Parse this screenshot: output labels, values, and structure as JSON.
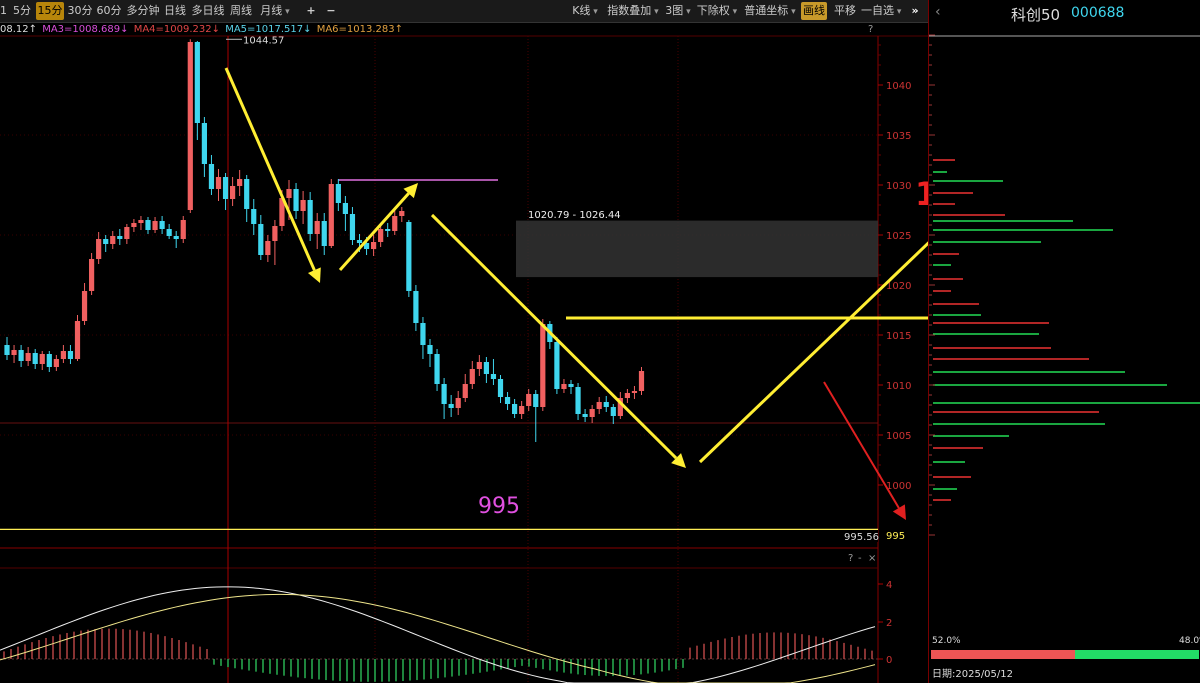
{
  "toolbar": {
    "periods": [
      "5分",
      "15分",
      "30分",
      "60分",
      "多分钟",
      "日线",
      "多日线",
      "周线",
      "月线"
    ],
    "active_period": "15分",
    "first_partial": "1",
    "zoom_in": "+",
    "zoom_out": "−",
    "right_buttons": [
      "K线",
      "指数叠加",
      "3图",
      "下除权",
      "普通坐标",
      "画线",
      "平移",
      "一自选"
    ],
    "collapse": "»"
  },
  "ma_legend": [
    {
      "text": "08.12↑",
      "color": "#dddddd"
    },
    {
      "text": "MA3=1008.689↓",
      "color": "#d84fd8"
    },
    {
      "text": "MA4=1009.232↓",
      "color": "#e04646"
    },
    {
      "text": "MA5=1017.517↓",
      "color": "#5ad2e8"
    },
    {
      "text": "MA6=1013.283↑",
      "color": "#e0a040"
    }
  ],
  "chart_data": {
    "type": "candlestick",
    "ylim": [
      993,
      1049
    ],
    "price_ticks": [
      1040,
      1035,
      1030,
      1025,
      1020,
      1015,
      1010,
      1005,
      1000
    ],
    "last_price_marker": "995",
    "support_line_label": "995.56",
    "annotation_995": "995",
    "high_label": "1044.57",
    "range_label": "1020.79 - 1026.44",
    "gap_zone": [
      1020.79,
      1026.44
    ],
    "support_level": 995.56,
    "horizontal_level": 1016.7,
    "candles": [
      [
        1014,
        1013,
        1014.8,
        1012.5
      ],
      [
        1013,
        1013.5,
        1014,
        1012.2
      ],
      [
        1013.5,
        1012.4,
        1014,
        1011.8
      ],
      [
        1012.4,
        1013.2,
        1013.8,
        1011.9
      ],
      [
        1013.2,
        1012.1,
        1013.6,
        1011.6
      ],
      [
        1012.1,
        1013.1,
        1013.4,
        1011.5
      ],
      [
        1013.1,
        1011.8,
        1013.4,
        1011.3
      ],
      [
        1011.8,
        1012.6,
        1013,
        1011.4
      ],
      [
        1012.6,
        1013.4,
        1014,
        1012.2
      ],
      [
        1013.4,
        1012.6,
        1014,
        1012.1
      ],
      [
        1012.6,
        1016.4,
        1017,
        1012.4
      ],
      [
        1016.4,
        1019.4,
        1020.2,
        1016
      ],
      [
        1019.4,
        1022.6,
        1023.2,
        1019
      ],
      [
        1022.6,
        1024.6,
        1025.3,
        1022.1
      ],
      [
        1024.6,
        1024.1,
        1025,
        1023.3
      ],
      [
        1024.1,
        1024.9,
        1025.4,
        1023.6
      ],
      [
        1024.9,
        1024.6,
        1025.6,
        1024
      ],
      [
        1024.6,
        1025.8,
        1026.1,
        1024.1
      ],
      [
        1025.8,
        1026.2,
        1026.6,
        1025.3
      ],
      [
        1026.2,
        1026.5,
        1026.9,
        1025.5
      ],
      [
        1026.5,
        1025.5,
        1026.8,
        1025.1
      ],
      [
        1025.5,
        1026.4,
        1026.8,
        1025.2
      ],
      [
        1026.4,
        1025.6,
        1026.9,
        1025.1
      ],
      [
        1025.6,
        1024.9,
        1026.1,
        1024.6
      ],
      [
        1024.9,
        1024.6,
        1025.4,
        1023.7
      ],
      [
        1024.6,
        1026.5,
        1026.9,
        1024.2
      ],
      [
        1027.5,
        1044.3,
        1044.57,
        1027.2
      ],
      [
        1044.3,
        1036.2,
        1044.4,
        1034.5
      ],
      [
        1036.2,
        1032.1,
        1036.8,
        1030.8
      ],
      [
        1032.1,
        1029.6,
        1033,
        1029
      ],
      [
        1029.6,
        1030.8,
        1031.6,
        1028.4
      ],
      [
        1030.8,
        1028.6,
        1031.2,
        1027.5
      ],
      [
        1028.6,
        1029.9,
        1030.8,
        1027.9
      ],
      [
        1029.9,
        1030.6,
        1031.5,
        1028.9
      ],
      [
        1030.6,
        1027.6,
        1031,
        1026.3
      ],
      [
        1027.6,
        1026.1,
        1028.6,
        1025
      ],
      [
        1026.1,
        1023,
        1027,
        1022.5
      ],
      [
        1023,
        1024.4,
        1025,
        1022.3
      ],
      [
        1024.4,
        1025.9,
        1026.5,
        1022
      ],
      [
        1025.9,
        1028.7,
        1029.5,
        1025.4
      ],
      [
        1028.7,
        1029.6,
        1030.5,
        1026.5
      ],
      [
        1029.6,
        1027.4,
        1030.2,
        1026.6
      ],
      [
        1027.4,
        1028.5,
        1029.4,
        1026.1
      ],
      [
        1028.5,
        1025.1,
        1029.3,
        1024.4
      ],
      [
        1025.1,
        1026.4,
        1027.2,
        1023.6
      ],
      [
        1026.4,
        1023.9,
        1027.2,
        1023
      ],
      [
        1023.9,
        1030.1,
        1030.6,
        1023.7
      ],
      [
        1030.1,
        1028.2,
        1030.6,
        1027.4
      ],
      [
        1028.2,
        1027.1,
        1028.9,
        1025.4
      ],
      [
        1027.1,
        1024.5,
        1027.8,
        1024
      ],
      [
        1024.5,
        1024.2,
        1025.1,
        1023.3
      ],
      [
        1024.2,
        1023.6,
        1024.8,
        1023
      ],
      [
        1023.6,
        1024.3,
        1025,
        1022.9
      ],
      [
        1024.3,
        1025.6,
        1026,
        1023.8
      ],
      [
        1025.6,
        1025.4,
        1026.2,
        1024.8
      ],
      [
        1025.4,
        1026.9,
        1027.5,
        1025
      ],
      [
        1026.9,
        1027.4,
        1027.8,
        1026.3
      ],
      [
        1026.3,
        1019.4,
        1026.5,
        1018.8
      ],
      [
        1019.4,
        1016.2,
        1020,
        1015.4
      ],
      [
        1016.2,
        1014,
        1016.8,
        1012.6
      ],
      [
        1014,
        1013.1,
        1014.6,
        1011.8
      ],
      [
        1013.1,
        1010.1,
        1013.6,
        1009.4
      ],
      [
        1010.1,
        1008.1,
        1010.7,
        1006.6
      ],
      [
        1008.1,
        1007.7,
        1009,
        1006.8
      ],
      [
        1007.7,
        1008.7,
        1009.4,
        1007
      ],
      [
        1008.7,
        1010.1,
        1011.1,
        1008.3
      ],
      [
        1010.1,
        1011.6,
        1012.4,
        1009.6
      ],
      [
        1011.6,
        1012.3,
        1013,
        1010.9
      ],
      [
        1012.3,
        1011.1,
        1012.8,
        1010.2
      ],
      [
        1011.1,
        1010.6,
        1012.6,
        1010
      ],
      [
        1010.6,
        1008.8,
        1011,
        1008.2
      ],
      [
        1008.8,
        1008.1,
        1009.3,
        1007.5
      ],
      [
        1008.1,
        1007.1,
        1008.6,
        1006.7
      ],
      [
        1007.1,
        1007.9,
        1008.4,
        1006.6
      ],
      [
        1007.9,
        1009.1,
        1009.6,
        1007.4
      ],
      [
        1009.1,
        1007.8,
        1009.5,
        1004.3
      ],
      [
        1007.8,
        1016.1,
        1016.6,
        1007.4
      ],
      [
        1016.1,
        1014.3,
        1016.4,
        1013.6
      ],
      [
        1014.3,
        1009.6,
        1014.8,
        1009.1
      ],
      [
        1009.6,
        1010.1,
        1010.6,
        1009.2
      ],
      [
        1010.1,
        1009.8,
        1010.5,
        1009.1
      ],
      [
        1009.8,
        1007.1,
        1010.2,
        1006.5
      ],
      [
        1007.1,
        1006.8,
        1007.6,
        1006.3
      ],
      [
        1006.8,
        1007.6,
        1008,
        1006.2
      ],
      [
        1007.6,
        1008.3,
        1008.8,
        1007.1
      ],
      [
        1008.3,
        1007.8,
        1008.9,
        1007.3
      ],
      [
        1007.8,
        1006.9,
        1008.1,
        1006.1
      ],
      [
        1006.9,
        1008.7,
        1009.3,
        1006.6
      ],
      [
        1008.7,
        1009.2,
        1009.6,
        1008.2
      ],
      [
        1009.2,
        1009.4,
        1009.9,
        1008.6
      ],
      [
        1009.4,
        1011.4,
        1011.8,
        1009
      ]
    ],
    "volume_profile": [
      {
        "price": 1027,
        "len": 72,
        "color": "red"
      },
      {
        "price": 1026.4,
        "len": 140,
        "color": "green"
      },
      {
        "price": 1025.5,
        "len": 180,
        "color": "green"
      },
      {
        "price": 1024.3,
        "len": 108,
        "color": "green"
      },
      {
        "price": 1023.1,
        "len": 26,
        "color": "red"
      },
      {
        "price": 1022,
        "len": 18,
        "color": "green"
      },
      {
        "price": 1020.6,
        "len": 30,
        "color": "red"
      },
      {
        "price": 1019.4,
        "len": 18,
        "color": "red"
      },
      {
        "price": 1018.1,
        "len": 46,
        "color": "red"
      },
      {
        "price": 1017,
        "len": 48,
        "color": "green"
      },
      {
        "price": 1016.2,
        "len": 116,
        "color": "red"
      },
      {
        "price": 1015.1,
        "len": 106,
        "color": "green"
      },
      {
        "price": 1013.7,
        "len": 118,
        "color": "red"
      },
      {
        "price": 1012.6,
        "len": 156,
        "color": "red"
      },
      {
        "price": 1011.3,
        "len": 192,
        "color": "green"
      },
      {
        "price": 1010,
        "len": 234,
        "color": "green"
      },
      {
        "price": 1008.2,
        "len": 268,
        "color": "green"
      },
      {
        "price": 1007.3,
        "len": 166,
        "color": "red"
      },
      {
        "price": 1006.1,
        "len": 172,
        "color": "green"
      },
      {
        "price": 1004.9,
        "len": 76,
        "color": "green"
      },
      {
        "price": 1003.7,
        "len": 50,
        "color": "red"
      },
      {
        "price": 1002.3,
        "len": 32,
        "color": "green"
      },
      {
        "price": 1000.8,
        "len": 38,
        "color": "red"
      },
      {
        "price": 999.6,
        "len": 24,
        "color": "green"
      },
      {
        "price": 998.5,
        "len": 18,
        "color": "red"
      },
      {
        "price": 1030.4,
        "len": 70,
        "color": "green"
      },
      {
        "price": 1029.2,
        "len": 40,
        "color": "red"
      },
      {
        "price": 1028.1,
        "len": 22,
        "color": "red"
      },
      {
        "price": 1032.5,
        "len": 22,
        "color": "red"
      },
      {
        "price": 1031.3,
        "len": 14,
        "color": "green"
      }
    ],
    "macd_ticks": [
      "4",
      "2",
      "0"
    ],
    "annotations": [
      "1",
      "2"
    ],
    "title": "",
    "xlabel": "",
    "ylabel": ""
  },
  "right_panel": {
    "back": "‹",
    "name": "科创50",
    "code": "000688",
    "pct_red": "52.0%",
    "pct_green": "48.0%",
    "date": "日期:2025/05/12"
  },
  "macd_controls": [
    "?",
    "-",
    "×"
  ],
  "main_controls": [
    "?"
  ],
  "colors": {
    "up": "#f06060",
    "down": "#3fd6ee",
    "arrow_yellow": "#ffee33",
    "arrow_red": "#e02020",
    "accent": "#c89a2a"
  }
}
